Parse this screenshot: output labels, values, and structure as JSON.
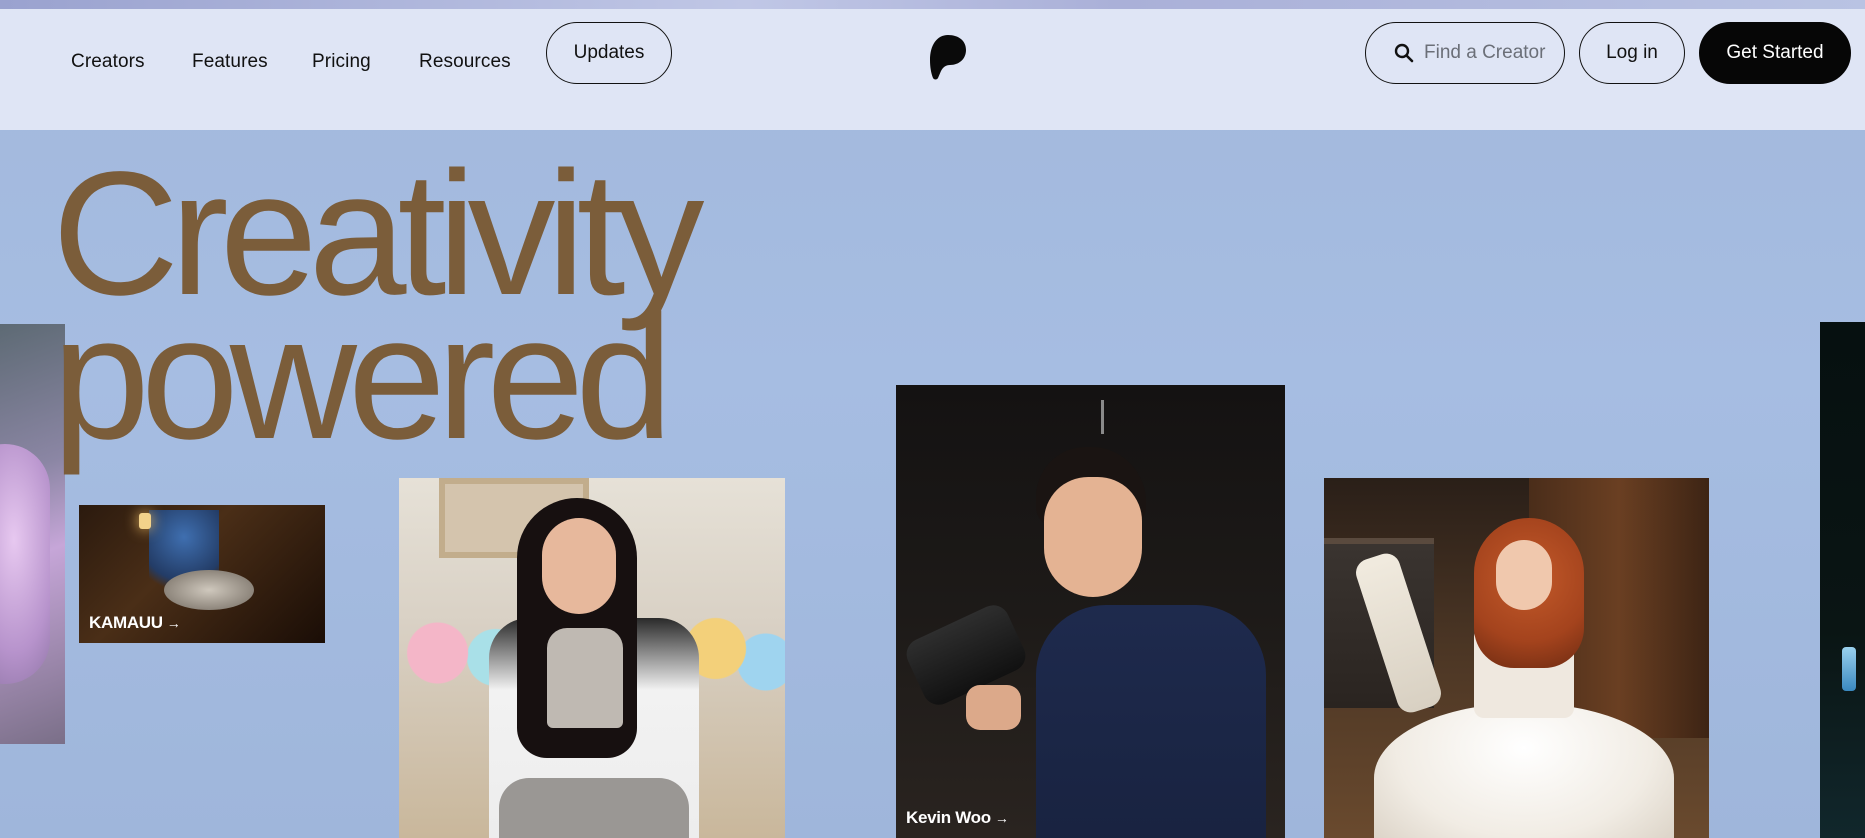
{
  "nav": {
    "links": [
      "Creators",
      "Features",
      "Pricing",
      "Resources"
    ],
    "updates_label": "Updates",
    "search_placeholder": "Find a Creator",
    "login_label": "Log in",
    "cta_label": "Get Started"
  },
  "hero": {
    "line1": "Creativity",
    "line2": "powered"
  },
  "creators": [
    {
      "name": "KAMAUU"
    },
    {
      "name": "Kevin Woo"
    }
  ],
  "colors": {
    "background": "#a3b9dd",
    "header": "#dfe5f5",
    "hero_text": "#7b5d3a",
    "cta": "#060606"
  },
  "icons": [
    "search-icon",
    "patreon-logo-icon",
    "arrow-right-icon"
  ]
}
